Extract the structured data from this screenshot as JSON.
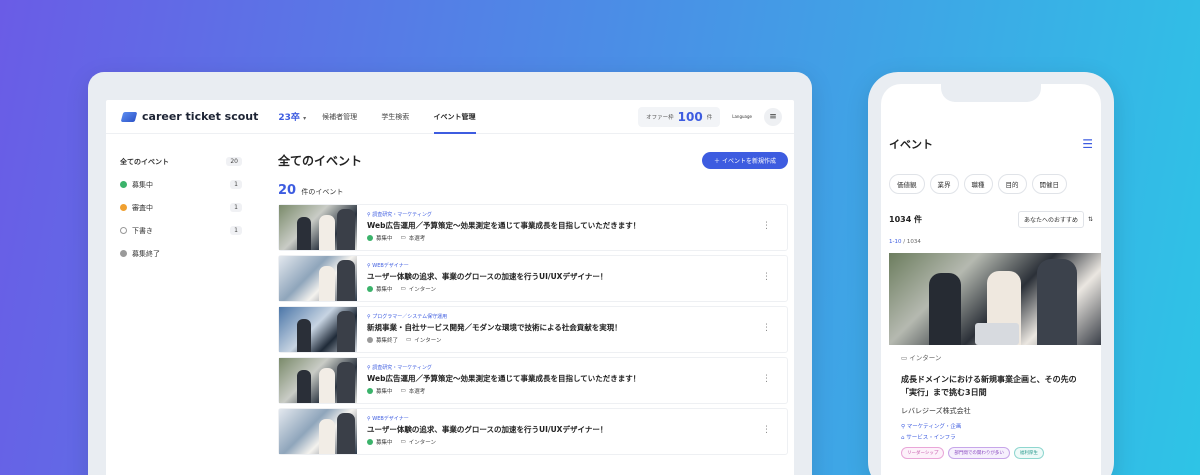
{
  "desktop": {
    "logo_text": "career ticket scout",
    "year": "23卒",
    "nav": [
      "候補者管理",
      "学生検索",
      "イベント管理"
    ],
    "offer_label": "オファー枠",
    "offer_count": "100",
    "offer_unit": "件",
    "language_label": "Language",
    "sidebar": [
      {
        "label": "全てのイベント",
        "count": "20",
        "color": ""
      },
      {
        "label": "募集中",
        "count": "1",
        "color": "#3bb36b"
      },
      {
        "label": "審査中",
        "count": "1",
        "color": "#f0a030"
      },
      {
        "label": "下書き",
        "count": "1",
        "color": "#ffffff"
      },
      {
        "label": "募集終了",
        "count": "",
        "color": "#9a9a9a"
      }
    ],
    "main_title": "全てのイベント",
    "create_button": "イベントを新規作成",
    "result_count": "20",
    "result_suffix": "件のイベント",
    "events": [
      {
        "category": "調査研究・マーケティング",
        "title": "Web広告運用／予算策定〜効果測定を通じて事業成長を目指していただきます！",
        "status": "募集中",
        "status_color": "#3bb36b",
        "type": "本選考"
      },
      {
        "category": "WEBデザイナー",
        "title": "ユーザー体験の追求、事業のグロースの加速を行うUI/UXデザイナー！",
        "status": "募集中",
        "status_color": "#3bb36b",
        "type": "インターン"
      },
      {
        "category": "プログラマー／システム保守運用",
        "title": "新規事業・自社サービス開発／モダンな環境で技術による社会貢献を実現！",
        "status": "募集終了",
        "status_color": "#9a9a9a",
        "type": "インターン"
      },
      {
        "category": "調査研究・マーケティング",
        "title": "Web広告運用／予算策定〜効果測定を通じて事業成長を目指していただきます！",
        "status": "募集中",
        "status_color": "#3bb36b",
        "type": "本選考"
      },
      {
        "category": "WEBデザイナー",
        "title": "ユーザー体験の追求、事業のグロースの加速を行うUI/UXデザイナー！",
        "status": "募集中",
        "status_color": "#3bb36b",
        "type": "インターン"
      }
    ]
  },
  "mobile": {
    "title": "イベント",
    "chips": [
      "価値観",
      "業界",
      "職種",
      "目的",
      "開催日"
    ],
    "count": "1034 件",
    "sort_label": "あなたへのおすすめ",
    "range_current": "1-10",
    "range_total": "1034",
    "card": {
      "type": "インターン",
      "title": "成長ドメインにおける新規事業企画と、その先の「実行」まで挑む3日間",
      "company": "レバレジーズ株式会社",
      "category": "マーケティング・企画",
      "industry": "サービス・インフラ",
      "tags": [
        "リーダーシップ",
        "部門間での関わりが多い",
        "福利厚生"
      ]
    }
  }
}
